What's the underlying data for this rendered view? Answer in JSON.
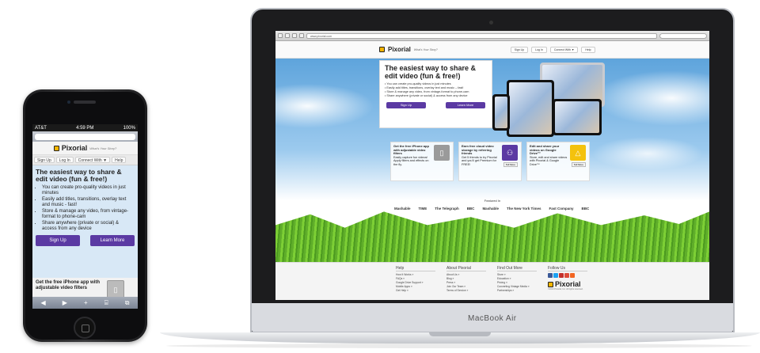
{
  "phone": {
    "status": {
      "carrier": "AT&T",
      "time": "4:59 PM",
      "battery": "100%"
    },
    "logo": "Pixorial",
    "tagline": "What's Your Story?",
    "nav": [
      "Sign Up",
      "Log In",
      "Connect With ▼",
      "Help"
    ],
    "hero_title": "The easiest way to share & edit video (fun & free!)",
    "bullets": [
      "You can create pro-quality videos in just minutes",
      "Easily add titles, transitions, overlay text and music - fast!",
      "Store & manage any video, from vintage-format to phone-cam",
      "Share anywhere (private or social) & access from any device"
    ],
    "signup": "Sign Up",
    "learn_more": "Learn More",
    "feature": "Get the free iPhone app with adjustable video filters",
    "toolbar": [
      "◀",
      "▶",
      "+",
      "⌸",
      "⧉"
    ]
  },
  "laptop": {
    "brand_label": "MacBook Air",
    "address": "www.pixorial.com",
    "logo": "Pixorial",
    "tagline": "What's Your Story?",
    "nav": [
      "Sign Up",
      "Log In",
      "Connect With ▼",
      "Help"
    ],
    "hero_title": "The easiest way to share & edit video (fun & free!)",
    "bullets": [
      "• You can create pro-quality videos in just minutes",
      "• Easily add titles, transitions, overlay text and music – fast!",
      "• Store & manage any video, from vintage-format to phone-cam",
      "• Share anywhere (private or social) & access from any device"
    ],
    "signup": "Sign Up",
    "learn_more": "Learn More",
    "features": [
      {
        "title": "Get the free iPhone app with adjustable video filters",
        "text": "Easily capture fun videos! Apply filters and effects on the fly.",
        "color": "#9a9a9a",
        "icon": "phone-icon"
      },
      {
        "title": "Earn free cloud video storage by referring friends",
        "text": "Get 5 friends to try Pixorial and you'll get Premium for FREE!",
        "color": "#5b3aa3",
        "icon": "people-icon",
        "more": "Tell More"
      },
      {
        "title": "Edit and share your videos on Google Drive™",
        "text": "Store, edit and share videos with Pixorial & Google Drive™",
        "color": "#f4c20d",
        "icon": "drive-icon",
        "more": "Tell More"
      }
    ],
    "featured_in": "Featured In",
    "press": [
      "Mashable",
      "TIME",
      "The Telegraph",
      "BBC",
      "Mashable",
      "The New York Times",
      "Fast Company",
      "BBC"
    ],
    "footer": {
      "help": {
        "title": "Help",
        "links": [
          "How It Works »",
          "FAQs »",
          "Google Drive Support »",
          "Mobile Apps »",
          "Get Help »"
        ]
      },
      "about": {
        "title": "About Pixorial",
        "links": [
          "About Us »",
          "Blog »",
          "Press »",
          "Join Our Team »",
          "Terms of Service »"
        ]
      },
      "more": {
        "title": "Find Out More",
        "links": [
          "Store »",
          "Education »",
          "Pricing »",
          "Converting Vintage Media »",
          "Partnerships »"
        ]
      },
      "follow": {
        "title": "Follow Us",
        "logo": "Pixorial",
        "copyright": "©2013 Pixorial, Inc. All rights reserved."
      }
    }
  }
}
